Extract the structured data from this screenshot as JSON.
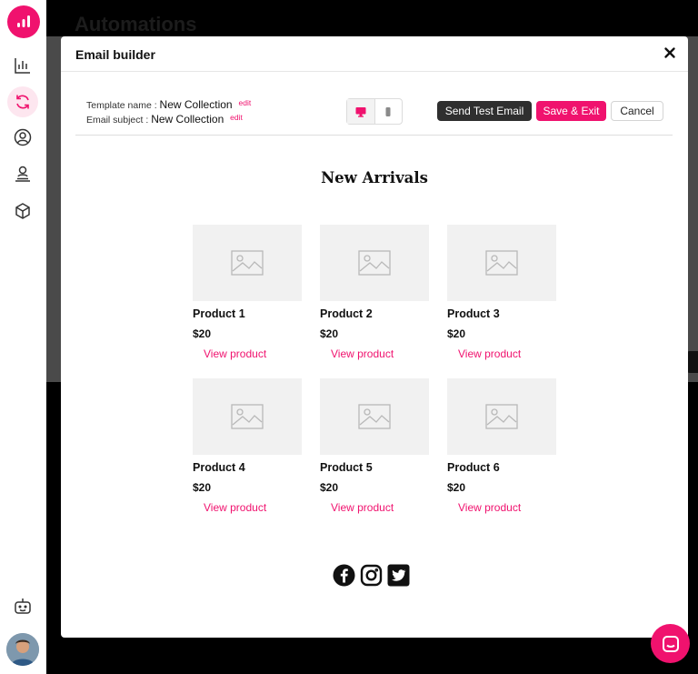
{
  "background": {
    "page_title": "Automations"
  },
  "sidebar": {
    "brand": "chart-logo",
    "items": [
      {
        "icon": "bar-chart-icon",
        "active": false
      },
      {
        "icon": "refresh-icon",
        "active": true
      },
      {
        "icon": "user-circle-icon",
        "active": false
      },
      {
        "icon": "location-user-icon",
        "active": false
      },
      {
        "icon": "box-icon",
        "active": false
      }
    ],
    "bottom_icon": "robot-icon"
  },
  "modal": {
    "title": "Email builder",
    "template_name_label": "Template name :",
    "template_name": "New Collection",
    "subject_label": "Email subject :",
    "subject": "New Collection",
    "edit_label": "edit",
    "send_test_label": "Send Test Email",
    "save_label": "Save & Exit",
    "cancel_label": "Cancel"
  },
  "email": {
    "heading": "New Arrivals",
    "products": [
      {
        "name": "Product 1",
        "price": "$20",
        "link": "View product"
      },
      {
        "name": "Product 2",
        "price": "$20",
        "link": "View product"
      },
      {
        "name": "Product 3",
        "price": "$20",
        "link": "View product"
      },
      {
        "name": "Product 4",
        "price": "$20",
        "link": "View product"
      },
      {
        "name": "Product 5",
        "price": "$20",
        "link": "View product"
      },
      {
        "name": "Product 6",
        "price": "$20",
        "link": "View product"
      }
    ],
    "social": [
      "facebook-icon",
      "instagram-icon",
      "twitter-icon"
    ]
  },
  "colors": {
    "accent": "#f0126e",
    "dark_button": "#2f2f2f"
  }
}
